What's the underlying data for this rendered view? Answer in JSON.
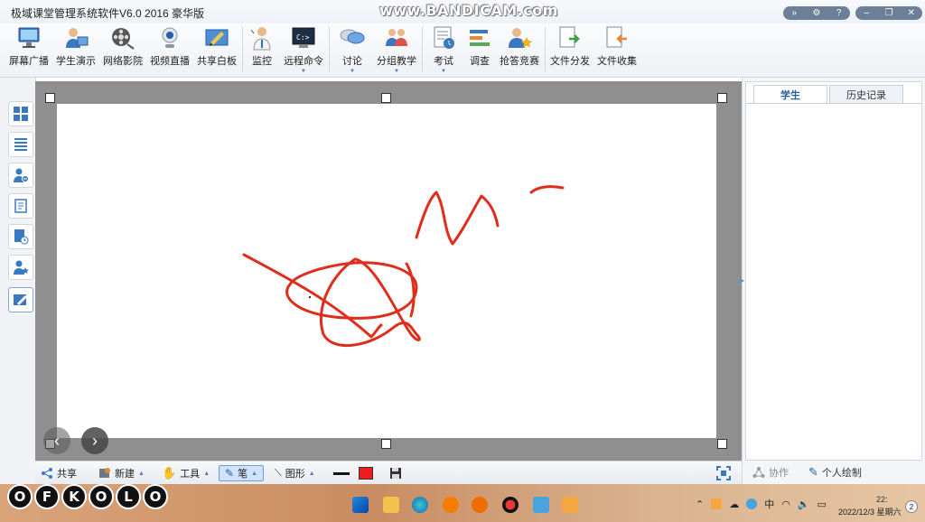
{
  "app": {
    "title": "极域课堂管理系统软件V6.0 2016 豪华版",
    "watermark": "www.BANDICAM.com"
  },
  "toolbar": {
    "items": [
      {
        "label": "屏幕广播",
        "icon": "screen-broadcast-icon"
      },
      {
        "label": "学生演示",
        "icon": "student-demo-icon"
      },
      {
        "label": "网络影院",
        "icon": "network-cinema-icon"
      },
      {
        "label": "视频直播",
        "icon": "video-live-icon"
      },
      {
        "label": "共享白板",
        "icon": "shared-whiteboard-icon"
      },
      {
        "label": "监控",
        "icon": "monitor-icon"
      },
      {
        "label": "远程命令",
        "icon": "remote-command-icon"
      },
      {
        "label": "讨论",
        "icon": "discussion-icon"
      },
      {
        "label": "分组教学",
        "icon": "group-teaching-icon"
      },
      {
        "label": "考试",
        "icon": "exam-icon"
      },
      {
        "label": "调查",
        "icon": "survey-icon"
      },
      {
        "label": "抢答竞赛",
        "icon": "quiz-contest-icon"
      },
      {
        "label": "文件分发",
        "icon": "file-distribute-icon"
      },
      {
        "label": "文件收集",
        "icon": "file-collect-icon"
      }
    ]
  },
  "bottom_toolbar": {
    "share": "共享",
    "new": "新建",
    "tools": "工具",
    "pen": "笔",
    "shapes": "图形",
    "pen_color": "#ee1c1c"
  },
  "right_panel": {
    "tab_students": "学生",
    "tab_history": "历史记录",
    "collaborate": "协作",
    "personal_draw": "个人绘制"
  },
  "taskbar": {
    "logo_letters": [
      "O",
      "F",
      "K",
      "O",
      "L",
      "O"
    ],
    "ime": "中",
    "time": "22:",
    "date": "2022/12/3 星期六",
    "notifications": "2"
  },
  "colors": {
    "ink": "#e02d1b",
    "accent": "#4a86c8"
  }
}
